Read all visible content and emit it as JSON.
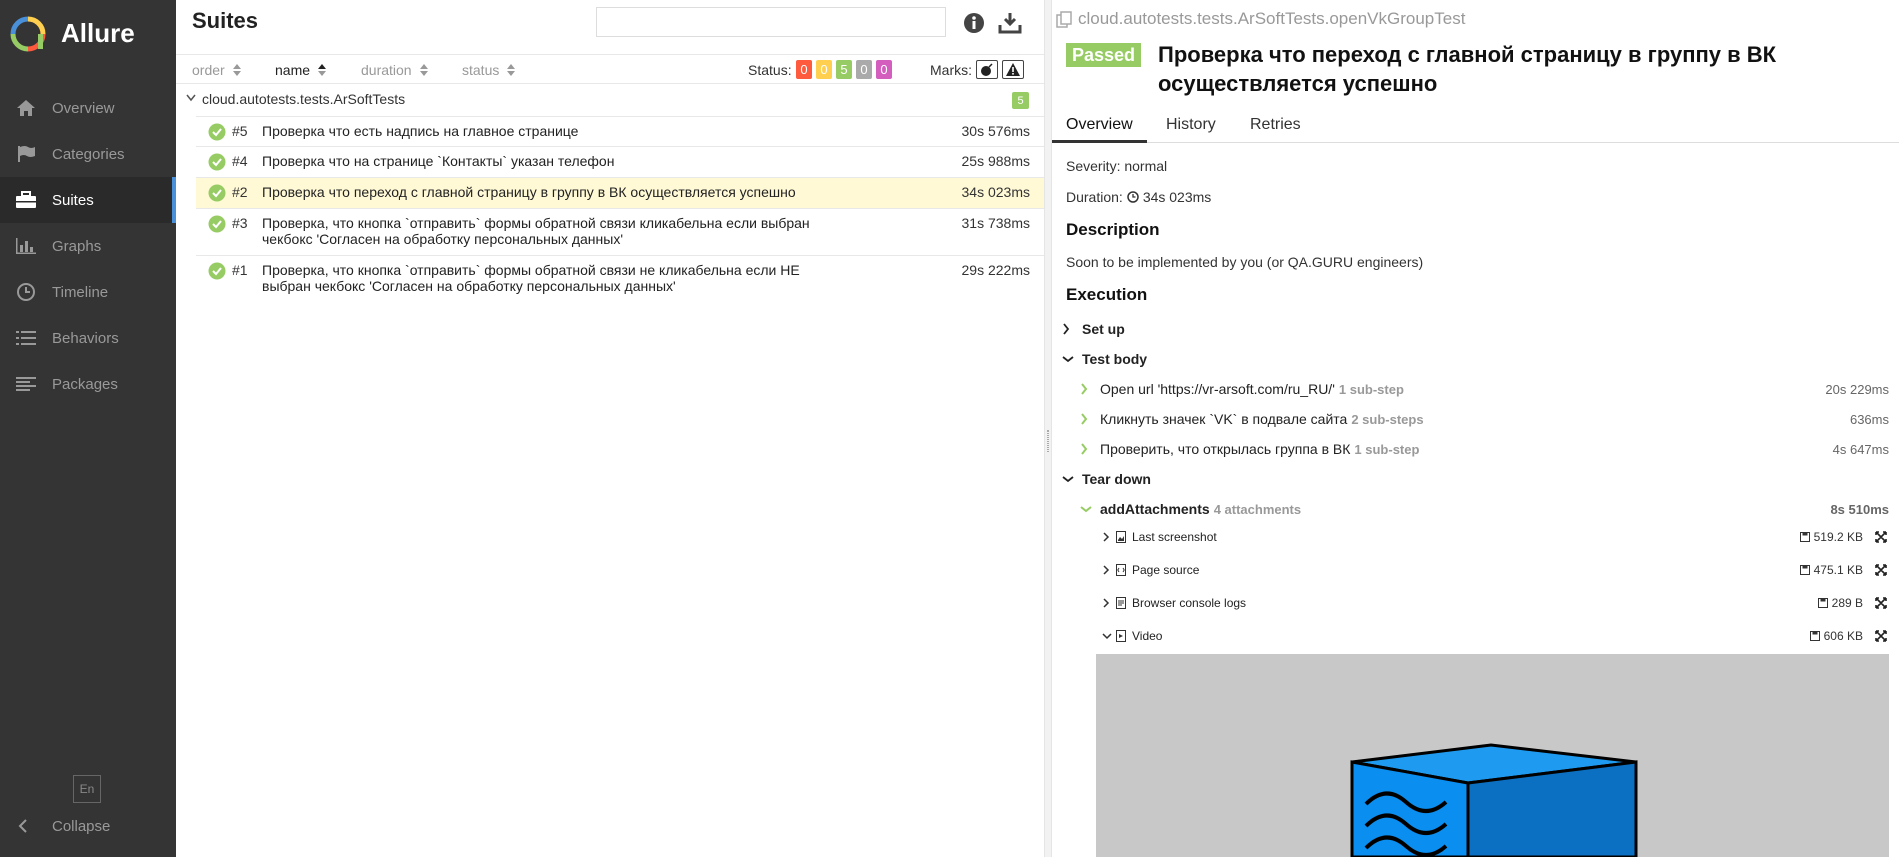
{
  "sidebar": {
    "brand": "Allure",
    "items": [
      {
        "label": "Overview",
        "icon": "home-icon"
      },
      {
        "label": "Categories",
        "icon": "flag-icon"
      },
      {
        "label": "Suites",
        "icon": "briefcase-icon"
      },
      {
        "label": "Graphs",
        "icon": "bar-chart-icon"
      },
      {
        "label": "Timeline",
        "icon": "clock-icon"
      },
      {
        "label": "Behaviors",
        "icon": "list-icon"
      },
      {
        "label": "Packages",
        "icon": "align-left-icon"
      }
    ],
    "lang": "En",
    "collapse": "Collapse"
  },
  "suites": {
    "title": "Suites",
    "search_placeholder": "",
    "sort": {
      "order": "order",
      "name": "name",
      "duration": "duration",
      "status": "status"
    },
    "status_label": "Status:",
    "status_counts": [
      {
        "value": "0",
        "color": "#fd5a3e"
      },
      {
        "value": "0",
        "color": "#ffd050"
      },
      {
        "value": "5",
        "color": "#97cc64"
      },
      {
        "value": "0",
        "color": "#aaaaaa"
      },
      {
        "value": "0",
        "color": "#d35ebe"
      }
    ],
    "marks_label": "Marks:",
    "group": {
      "name": "cloud.autotests.tests.ArSoftTests",
      "count": "5"
    },
    "rows": [
      {
        "num": "#5",
        "name": "Проверка что есть надпись на главное странице",
        "duration": "30s 576ms"
      },
      {
        "num": "#4",
        "name": "Проверка что на странице `Контакты` указан телефон",
        "duration": "25s 988ms"
      },
      {
        "num": "#2",
        "name": "Проверка что переход с главной страницу в группу в ВК осуществляется успешно",
        "duration": "34s 023ms"
      },
      {
        "num": "#3",
        "name": "Проверка, что кнопка `отправить` формы обратной связи кликабельна если выбран чекбокс 'Согласен на обработку персональных данных'",
        "duration": "31s 738ms"
      },
      {
        "num": "#1",
        "name": "Проверка, что кнопка `отправить` формы обратной связи не кликабельна если НЕ выбран чекбокс 'Согласен на обработку персональных данных'",
        "duration": "29s 222ms"
      }
    ]
  },
  "detail": {
    "breadcrumb": "cloud.autotests.tests.ArSoftTests.openVkGroupTest",
    "status": "Passed",
    "title": "Проверка что переход с главной страницу в группу в ВК осуществляется успешно",
    "tabs": [
      "Overview",
      "History",
      "Retries"
    ],
    "severity": "Severity: normal",
    "duration_label": "Duration:",
    "duration_value": "34s 023ms",
    "description_heading": "Description",
    "description": "Soon to be implemented by you (or QA.GURU engineers)",
    "execution_heading": "Execution",
    "setup": "Set up",
    "test_body": "Test body",
    "steps": [
      {
        "name": "Open url 'https://vr-arsoft.com/ru_RU/'",
        "sub": "1 sub-step",
        "duration": "20s 229ms"
      },
      {
        "name": "Кликнуть значек `VK` в подвале сайта",
        "sub": "2 sub-steps",
        "duration": "636ms"
      },
      {
        "name": "Проверить, что открылась группа в ВК",
        "sub": "1 sub-step",
        "duration": "4s 647ms"
      }
    ],
    "tear_down": "Tear down",
    "add_attachments": {
      "name": "addAttachments",
      "sub": "4 attachments",
      "duration": "8s 510ms"
    },
    "attachments": [
      {
        "name": "Last screenshot",
        "size": "519.2 KB",
        "icon": "image-file-icon"
      },
      {
        "name": "Page source",
        "size": "475.1 KB",
        "icon": "code-file-icon"
      },
      {
        "name": "Browser console logs",
        "size": "289 B",
        "icon": "text-file-icon"
      },
      {
        "name": "Video",
        "size": "606 KB",
        "icon": "video-file-icon"
      }
    ]
  }
}
